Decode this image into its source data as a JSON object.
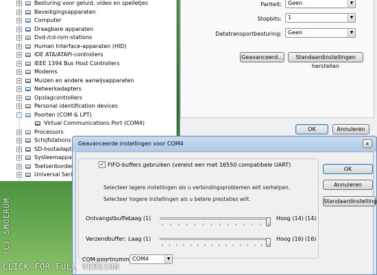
{
  "device_tree": {
    "items": [
      {
        "label": "Besturing voor geluid, video en spelletjes",
        "icon": "speaker-icon",
        "expander": "+"
      },
      {
        "label": "Beveiligingsapparaten",
        "icon": "security-device-icon",
        "expander": "+"
      },
      {
        "label": "Computer",
        "icon": "computer-icon",
        "expander": "+"
      },
      {
        "label": "Draagbare apparaten",
        "icon": "portable-device-icon",
        "expander": "+"
      },
      {
        "label": "Dvd-/cd-rom-stations",
        "icon": "disc-drive-icon",
        "expander": "+"
      },
      {
        "label": "Human Interface-apparaten (HID)",
        "icon": "hid-icon",
        "expander": "+"
      },
      {
        "label": "IDE ATA/ATAPI-controllers",
        "icon": "ide-controller-icon",
        "expander": "+"
      },
      {
        "label": "IEEE 1394 Bus Host Controllers",
        "icon": "firewire-icon",
        "expander": "+"
      },
      {
        "label": "Modems",
        "icon": "modem-icon",
        "expander": "+"
      },
      {
        "label": "Muizen en andere aanwijsapparaten",
        "icon": "mouse-icon",
        "expander": "+"
      },
      {
        "label": "Netwerkadapters",
        "icon": "network-adapter-icon",
        "expander": "+"
      },
      {
        "label": "Opslagcontrollers",
        "icon": "storage-controller-icon",
        "expander": "+"
      },
      {
        "label": "Personal identification devices",
        "icon": "id-device-icon",
        "expander": "+"
      },
      {
        "label": "Poorten (COM & LPT)",
        "icon": "port-icon",
        "expander": "-"
      },
      {
        "label": "Virtual Communications Port (COM4)",
        "icon": "port-icon",
        "child": true
      },
      {
        "label": "Processors",
        "icon": "processor-icon",
        "expander": "+"
      },
      {
        "label": "Schijfstations",
        "icon": "disk-drive-icon",
        "expander": "+"
      },
      {
        "label": "SD-hostadapte",
        "icon": "sd-adapter-icon",
        "expander": "+"
      },
      {
        "label": "Systeemappara",
        "icon": "system-device-icon",
        "expander": "+"
      },
      {
        "label": "Toetsenborden",
        "icon": "keyboard-icon",
        "expander": "+"
      },
      {
        "label": "Universal Serial",
        "icon": "usb-icon",
        "expander": "+"
      }
    ]
  },
  "port_settings": {
    "rows": [
      {
        "label": "Pariteit:",
        "value": "Geen"
      },
      {
        "label": "Stopbits:",
        "value": "1"
      },
      {
        "label": "Datatransportbesturing:",
        "value": "Geen"
      }
    ],
    "advanced_button": "Geavanceerd...",
    "restore_button": "Standaardinstellingen herstellen",
    "ok_button": "OK",
    "cancel_button": "Annuleren"
  },
  "advanced_dialog": {
    "title": "Geavanceerde instellingen voor COM4",
    "close_glyph": "x",
    "fifo_checkbox_label": "FIFO-buffers gebruiken (vereist een met 16550 compatibele UART)",
    "fifo_checked": true,
    "note_low": "Selecteer lagere instellingen als u verbindingsproblemen wilt verhelpen.",
    "note_high": "Selecteer hogere instellingen als u betere prestaties wilt.",
    "receive_buffer": {
      "label": "Ontvangstbuffer:",
      "low": "Laag (1)",
      "high": "Hoog (14)",
      "value_text": "(14)",
      "value": 14,
      "min": 1,
      "max": 14
    },
    "transmit_buffer": {
      "label": "Verzendbuffer:",
      "low": "Laag (1)",
      "high": "Hoog (16)",
      "value_text": "(16)",
      "value": 16,
      "min": 1,
      "max": 16
    },
    "com_port_label": "COM-poortnummer:",
    "com_port_value": "COM4",
    "ok_button": "OK",
    "cancel_button": "Annuleren",
    "defaults_button": "Standaardinstellingen"
  },
  "watermarks": {
    "side": "(C) SMOERUM",
    "bottom": "CLICK FOR FULL VERSION"
  }
}
